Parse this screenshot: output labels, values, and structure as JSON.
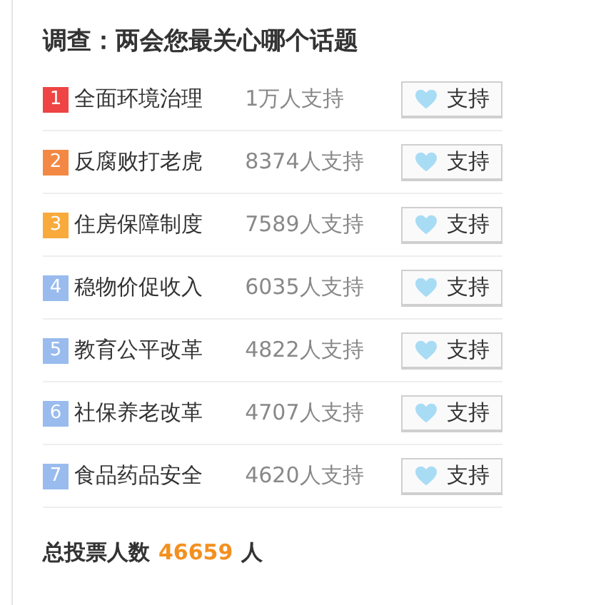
{
  "title": "调查：两会您最关心哪个话题",
  "items": [
    {
      "rank": "1",
      "color": "#ee4444",
      "name": "全面环境治理",
      "count": "1万人支持",
      "button": "支持"
    },
    {
      "rank": "2",
      "color": "#f38844",
      "name": "反腐败打老虎",
      "count": "8374人支持",
      "button": "支持"
    },
    {
      "rank": "3",
      "color": "#f8aa3c",
      "name": "住房保障制度",
      "count": "7589人支持",
      "button": "支持"
    },
    {
      "rank": "4",
      "color": "#99bbee",
      "name": "稳物价促收入",
      "count": "6035人支持",
      "button": "支持"
    },
    {
      "rank": "5",
      "color": "#99bbee",
      "name": "教育公平改革",
      "count": "4822人支持",
      "button": "支持"
    },
    {
      "rank": "6",
      "color": "#99bbee",
      "name": "社保养老改革",
      "count": "4707人支持",
      "button": "支持"
    },
    {
      "rank": "7",
      "color": "#99bbee",
      "name": "食品药品安全",
      "count": "4620人支持",
      "button": "支持"
    }
  ],
  "total": {
    "label": "总投票人数",
    "value": "46659",
    "unit": "人"
  }
}
